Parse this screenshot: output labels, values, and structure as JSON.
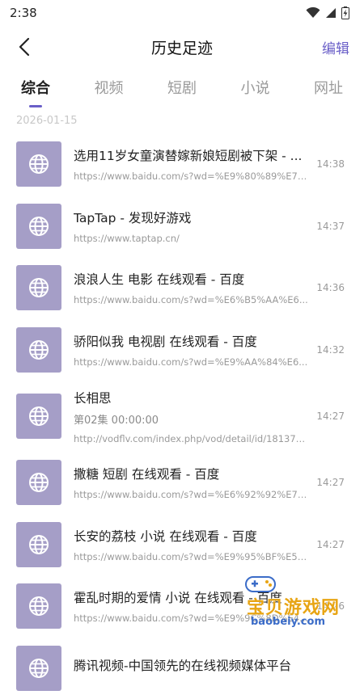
{
  "status": {
    "time": "2:38"
  },
  "header": {
    "title": "历史足迹",
    "edit_label": "编辑"
  },
  "tabs": [
    {
      "label": "综合",
      "active": true
    },
    {
      "label": "视频",
      "active": false
    },
    {
      "label": "短剧",
      "active": false
    },
    {
      "label": "小说",
      "active": false
    },
    {
      "label": "网址",
      "active": false
    }
  ],
  "date_group": "2026-01-15",
  "items": [
    {
      "title": "选用11岁女童演替嫁新娘短剧被下架 - ...",
      "url": "https://www.baidu.com/s?wd=%E9%80%89%E7%9...",
      "time": "14:38"
    },
    {
      "title": "TapTap - 发现好游戏",
      "url": "https://www.taptap.cn/",
      "time": "14:37"
    },
    {
      "title": "浪浪人生 电影 在线观看 - 百度",
      "url": "https://www.baidu.com/s?wd=%E6%B5%AA%E6...",
      "time": "14:36"
    },
    {
      "title": "骄阳似我 电视剧 在线观看 - 百度",
      "url": "https://www.baidu.com/s?wd=%E9%AA%84%E6...",
      "time": "14:32"
    },
    {
      "title": "长相思",
      "subtitle": "第02集 00:00:00",
      "url": "http://vodflv.com/index.php/vod/detail/id/181370...",
      "time": "14:27"
    },
    {
      "title": "撒糖 短剧 在线观看 - 百度",
      "url": "https://www.baidu.com/s?wd=%E6%92%92%E7%B...",
      "time": "14:27"
    },
    {
      "title": "长安的荔枝 小说 在线观看 - 百度",
      "url": "https://www.baidu.com/s?wd=%E9%95%BF%E5%...",
      "time": "14:27"
    },
    {
      "title": "霍乱时期的爱情 小说 在线观看 - 百度",
      "url": "https://www.baidu.com/s?wd=%E9%9C%8D%E4...",
      "time": "14:26"
    },
    {
      "title": "腾讯视频-中国领先的在线视频媒体平台",
      "url": "",
      "time": ""
    }
  ],
  "watermark": {
    "text": "宝贝游戏网",
    "sub": "baobeiy.com"
  },
  "colors": {
    "accent": "#6a5fc8",
    "thumb": "#a59ec7"
  }
}
